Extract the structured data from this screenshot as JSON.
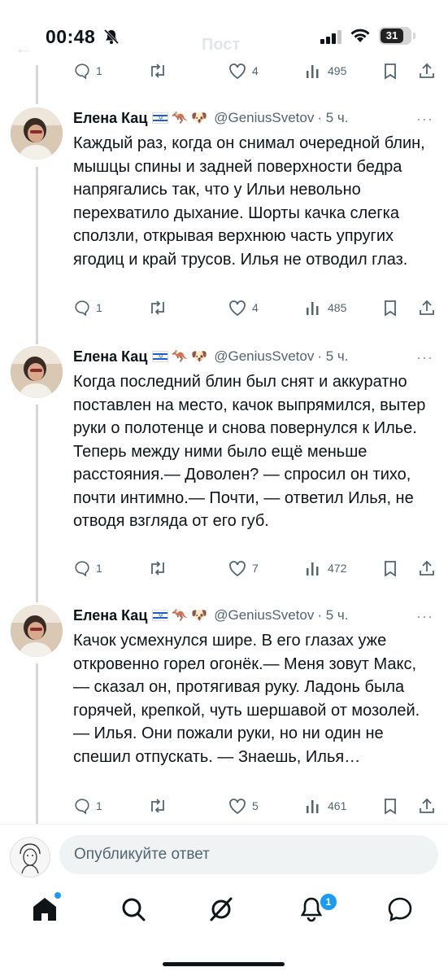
{
  "status_bar": {
    "time": "00:48",
    "battery": "31"
  },
  "header": {
    "title": "Пост"
  },
  "top_actions": {
    "replies": "1",
    "retweets": "",
    "likes": "4",
    "views": "495"
  },
  "tweets": [
    {
      "name": "Елена Кац",
      "handle": "@GeniusSvetov",
      "time": "· 5 ч.",
      "text": "Каждый раз, когда он снимал очередной блин, мышцы спины и задней поверхности бедра напрягались так, что у Ильи невольно перехватило дыхание. Шорты качка слегка сползли, открывая верхнюю часть упругих ягодиц и край трусов. Илья не отводил глаз.",
      "replies": "1",
      "likes": "4",
      "views": "485"
    },
    {
      "name": "Елена Кац",
      "handle": "@GeniusSvetov",
      "time": "· 5 ч.",
      "text": "Когда последний блин был снят и аккуратно поставлен на место, качок выпрямился, вытер руки о полотенце и снова повернулся к Илье. Теперь между ними было ещё меньше расстояния.— Доволен? — спросил он тихо, почти интимно.— Почти, — ответил Илья, не отводя взгляда от его губ.",
      "replies": "1",
      "likes": "7",
      "views": "472"
    },
    {
      "name": "Елена Кац",
      "handle": "@GeniusSvetov",
      "time": "· 5 ч.",
      "text": "Качок усмехнулся шире. В его глазах уже откровенно горел огонёк.— Меня зовут Макс, — сказал он, протягивая руку. Ладонь была горячей, крепкой, чуть шершавой от мозолей. — Илья. Они пожали руки, но ни один не спешил отпускать. — Знаешь, Илья…",
      "replies": "1",
      "likes": "5",
      "views": "461"
    }
  ],
  "reply": {
    "placeholder": "Опубликуйте ответ"
  },
  "nav": {
    "notifications_badge": "1"
  },
  "colors": {
    "accent": "#1d9bf0",
    "muted": "#536471",
    "text": "#0f1419"
  }
}
